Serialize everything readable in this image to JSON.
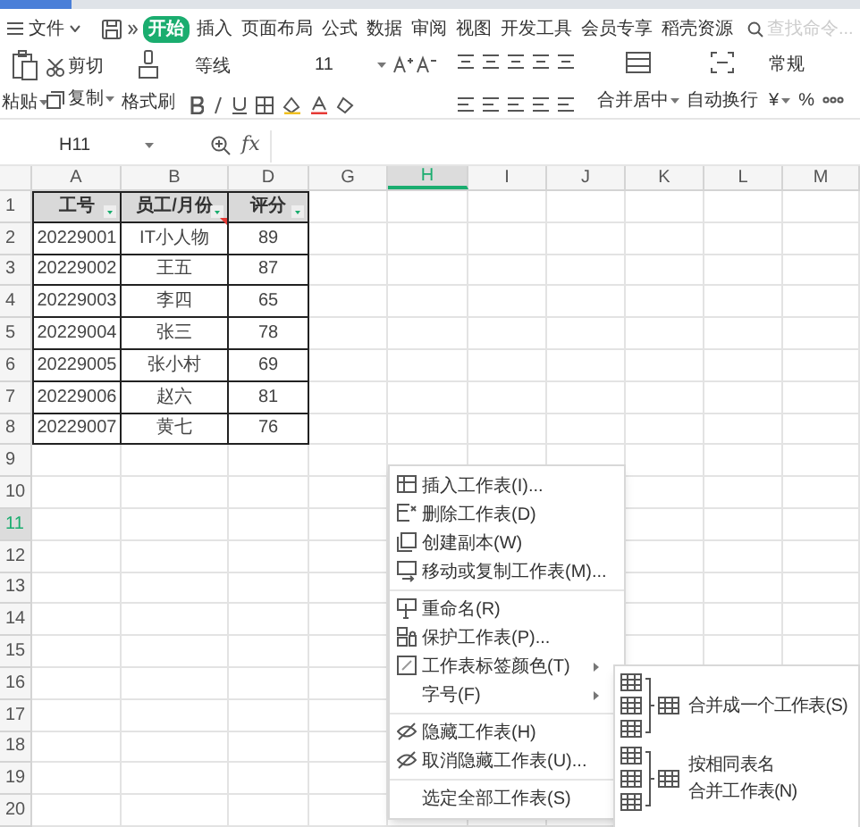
{
  "menu_bar": {
    "file_menu": "文件",
    "tabs": [
      {
        "label": "开始",
        "selected": true
      },
      {
        "label": "插入",
        "selected": false
      },
      {
        "label": "页面布局",
        "selected": false
      },
      {
        "label": "公式",
        "selected": false
      },
      {
        "label": "数据",
        "selected": false
      },
      {
        "label": "审阅",
        "selected": false
      },
      {
        "label": "视图",
        "selected": false
      },
      {
        "label": "开发工具",
        "selected": false
      },
      {
        "label": "会员专享",
        "selected": false
      },
      {
        "label": "稻壳资源",
        "selected": false
      }
    ],
    "search": {
      "placeholder": "查找命令..."
    }
  },
  "ribbon": {
    "paste": "粘贴",
    "cut": "剪切",
    "copy": "复制",
    "format_painter": "格式刷",
    "font_name": "等线",
    "font_size": "11",
    "merge_center": "合并居中",
    "wrap_text": "自动换行",
    "number_format": "常规",
    "currency": "¥",
    "percent": "%"
  },
  "formula_bar": {
    "name_box": "H11",
    "fx": "fx"
  },
  "sheet": {
    "columns": [
      {
        "label": "A",
        "selected": false
      },
      {
        "label": "B",
        "selected": false
      },
      {
        "label": "D",
        "selected": false
      },
      {
        "label": "G",
        "selected": false
      },
      {
        "label": "H",
        "selected": true
      },
      {
        "label": "I",
        "selected": false
      },
      {
        "label": "J",
        "selected": false
      },
      {
        "label": "K",
        "selected": false
      },
      {
        "label": "L",
        "selected": false
      },
      {
        "label": "M",
        "selected": false
      }
    ],
    "rows": [
      {
        "label": "1",
        "selected": false
      },
      {
        "label": "2",
        "selected": false
      },
      {
        "label": "3",
        "selected": false
      },
      {
        "label": "4",
        "selected": false
      },
      {
        "label": "5",
        "selected": false
      },
      {
        "label": "6",
        "selected": false
      },
      {
        "label": "7",
        "selected": false
      },
      {
        "label": "8",
        "selected": false
      },
      {
        "label": "9",
        "selected": false
      },
      {
        "label": "10",
        "selected": false
      },
      {
        "label": "11",
        "selected": true
      },
      {
        "label": "12",
        "selected": false
      },
      {
        "label": "13",
        "selected": false
      },
      {
        "label": "14",
        "selected": false
      },
      {
        "label": "15",
        "selected": false
      },
      {
        "label": "16",
        "selected": false
      },
      {
        "label": "17",
        "selected": false
      },
      {
        "label": "18",
        "selected": false
      },
      {
        "label": "19",
        "selected": false
      },
      {
        "label": "20",
        "selected": false
      }
    ],
    "table": {
      "header": [
        "工号",
        "员工/月份",
        "评分"
      ],
      "rows": [
        [
          "20229001",
          "IT小人物",
          "89"
        ],
        [
          "20229002",
          "王五",
          "87"
        ],
        [
          "20229003",
          "李四",
          "65"
        ],
        [
          "20229004",
          "张三",
          "78"
        ],
        [
          "20229005",
          "张小村",
          "69"
        ],
        [
          "20229006",
          "赵六",
          "81"
        ],
        [
          "20229007",
          "黄七",
          "76"
        ]
      ]
    }
  },
  "context_menu": {
    "groups": [
      [
        {
          "label": "插入工作表(I)...",
          "submenu": false
        },
        {
          "label": "删除工作表(D)",
          "submenu": false
        },
        {
          "label": "创建副本(W)",
          "submenu": false
        },
        {
          "label": "移动或复制工作表(M)...",
          "submenu": false
        }
      ],
      [
        {
          "label": "重命名(R)",
          "submenu": false
        },
        {
          "label": "保护工作表(P)...",
          "submenu": false
        },
        {
          "label": "工作表标签颜色(T)",
          "submenu": true
        },
        {
          "label": "字号(F)",
          "submenu": true
        }
      ],
      [
        {
          "label": "隐藏工作表(H)",
          "submenu": false
        },
        {
          "label": "取消隐藏工作表(U)...",
          "submenu": false
        }
      ],
      [
        {
          "label": "选定全部工作表(S)",
          "submenu": false
        }
      ]
    ]
  },
  "submenu": {
    "options": [
      {
        "lines": [
          "合并成一个工作表(S)"
        ]
      },
      {
        "lines": [
          "按相同表名",
          "合并工作表(N)"
        ]
      }
    ]
  }
}
